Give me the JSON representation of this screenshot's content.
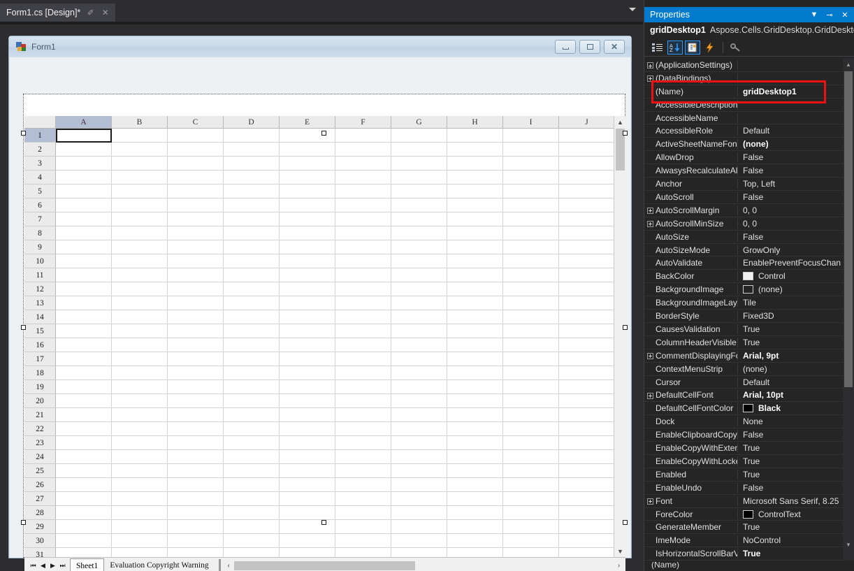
{
  "editor": {
    "tab": {
      "label": "Form1.cs [Design]*",
      "pin": "✐",
      "close": "✕"
    },
    "overflow_chevron": "chevron-down"
  },
  "form": {
    "title": "Form1",
    "buttons": {
      "minimize": "–",
      "maximize": "□",
      "close": "✕"
    }
  },
  "grid": {
    "namebox_value": "",
    "namebox_chevron": "⌄",
    "formula_value": "",
    "columns": [
      "A",
      "B",
      "C",
      "D",
      "E",
      "F",
      "G",
      "H",
      "I",
      "J"
    ],
    "rows": [
      "1",
      "2",
      "3",
      "4",
      "5",
      "6",
      "7",
      "8",
      "9",
      "10",
      "11",
      "12",
      "13",
      "14",
      "15",
      "16",
      "17",
      "18",
      "19",
      "20",
      "21",
      "22",
      "23",
      "24",
      "25",
      "26",
      "27",
      "28",
      "29",
      "30",
      "31"
    ],
    "active_cell": "A1",
    "selected_column": "A",
    "selected_row": "1",
    "nav_buttons": [
      "⏮",
      "◀",
      "▶",
      "⏭"
    ],
    "sheet_tabs": [
      {
        "name": "Sheet1",
        "active": true
      },
      {
        "name": "Evaluation Copyright Warning",
        "active": false
      }
    ],
    "hscroll_left": "‹",
    "hscroll_right": "›",
    "vscroll_up": "▲",
    "vscroll_down": "▼"
  },
  "properties_panel": {
    "title": "Properties",
    "title_buttons": {
      "dropdown": "▼",
      "pin": "⊸",
      "close": "✕"
    },
    "object_name": "gridDesktop1",
    "object_type": "Aspose.Cells.GridDesktop.GridDesktc",
    "object_chevron": "▾",
    "toolbar_icons": [
      {
        "name": "categorized-view-icon",
        "active": false
      },
      {
        "name": "alphabetical-sort-icon",
        "active": true
      },
      {
        "name": "properties-page-icon",
        "active": true
      },
      {
        "name": "events-icon",
        "active": false
      },
      {
        "name": "property-pages-key-icon",
        "active": false
      }
    ],
    "scroll_up": "▲",
    "scroll_down": "▼",
    "description_text": "(Name)",
    "rows": [
      {
        "expander": true,
        "name": "(ApplicationSettings)",
        "value": "",
        "bold": false
      },
      {
        "expander": true,
        "name": "(DataBindings)",
        "value": "",
        "bold": false
      },
      {
        "expander": false,
        "name": "(Name)",
        "value": "gridDesktop1",
        "bold": true
      },
      {
        "expander": false,
        "name": "AccessibleDescription",
        "value": "",
        "bold": false
      },
      {
        "expander": false,
        "name": "AccessibleName",
        "value": "",
        "bold": false
      },
      {
        "expander": false,
        "name": "AccessibleRole",
        "value": "Default",
        "bold": false
      },
      {
        "expander": false,
        "name": "ActiveSheetNameFont",
        "value": "(none)",
        "bold": true
      },
      {
        "expander": false,
        "name": "AllowDrop",
        "value": "False",
        "bold": false
      },
      {
        "expander": false,
        "name": "AlwasysRecalculateAllF",
        "value": "False",
        "bold": false
      },
      {
        "expander": false,
        "name": "Anchor",
        "value": "Top, Left",
        "bold": false
      },
      {
        "expander": false,
        "name": "AutoScroll",
        "value": "False",
        "bold": false
      },
      {
        "expander": true,
        "name": "AutoScrollMargin",
        "value": "0, 0",
        "bold": false
      },
      {
        "expander": true,
        "name": "AutoScrollMinSize",
        "value": "0, 0",
        "bold": false
      },
      {
        "expander": false,
        "name": "AutoSize",
        "value": "False",
        "bold": false
      },
      {
        "expander": false,
        "name": "AutoSizeMode",
        "value": "GrowOnly",
        "bold": false
      },
      {
        "expander": false,
        "name": "AutoValidate",
        "value": "EnablePreventFocusChan",
        "bold": false
      },
      {
        "expander": false,
        "name": "BackColor",
        "value": "Control",
        "bold": false,
        "swatch": "#f0f0f0"
      },
      {
        "expander": false,
        "name": "BackgroundImage",
        "value": "(none)",
        "bold": false,
        "swatch": "#252526"
      },
      {
        "expander": false,
        "name": "BackgroundImageLayo",
        "value": "Tile",
        "bold": false
      },
      {
        "expander": false,
        "name": "BorderStyle",
        "value": "Fixed3D",
        "bold": false
      },
      {
        "expander": false,
        "name": "CausesValidation",
        "value": "True",
        "bold": false
      },
      {
        "expander": false,
        "name": "ColumnHeaderVisible",
        "value": "True",
        "bold": false
      },
      {
        "expander": true,
        "name": "CommentDisplayingFo",
        "value": "Arial, 9pt",
        "bold": true
      },
      {
        "expander": false,
        "name": "ContextMenuStrip",
        "value": "(none)",
        "bold": false
      },
      {
        "expander": false,
        "name": "Cursor",
        "value": "Default",
        "bold": false
      },
      {
        "expander": true,
        "name": "DefaultCellFont",
        "value": "Arial, 10pt",
        "bold": true
      },
      {
        "expander": false,
        "name": "DefaultCellFontColor",
        "value": "Black",
        "bold": true,
        "swatch": "#000000"
      },
      {
        "expander": false,
        "name": "Dock",
        "value": "None",
        "bold": false
      },
      {
        "expander": false,
        "name": "EnableClipboardCopyP",
        "value": "False",
        "bold": false
      },
      {
        "expander": false,
        "name": "EnableCopyWithExtensi",
        "value": "True",
        "bold": false
      },
      {
        "expander": false,
        "name": "EnableCopyWithLocked",
        "value": "True",
        "bold": false
      },
      {
        "expander": false,
        "name": "Enabled",
        "value": "True",
        "bold": false
      },
      {
        "expander": false,
        "name": "EnableUndo",
        "value": "False",
        "bold": false
      },
      {
        "expander": true,
        "name": "Font",
        "value": "Microsoft Sans Serif, 8.25",
        "bold": false
      },
      {
        "expander": false,
        "name": "ForeColor",
        "value": "ControlText",
        "bold": false,
        "swatch": "#000000"
      },
      {
        "expander": false,
        "name": "GenerateMember",
        "value": "True",
        "bold": false
      },
      {
        "expander": false,
        "name": "ImeMode",
        "value": "NoControl",
        "bold": false
      },
      {
        "expander": false,
        "name": "IsHorizontalScrollBarVis",
        "value": "True",
        "bold": true
      }
    ]
  },
  "annotation": {
    "highlight_color": "#ee1111",
    "highlights_row": "(Name)"
  }
}
